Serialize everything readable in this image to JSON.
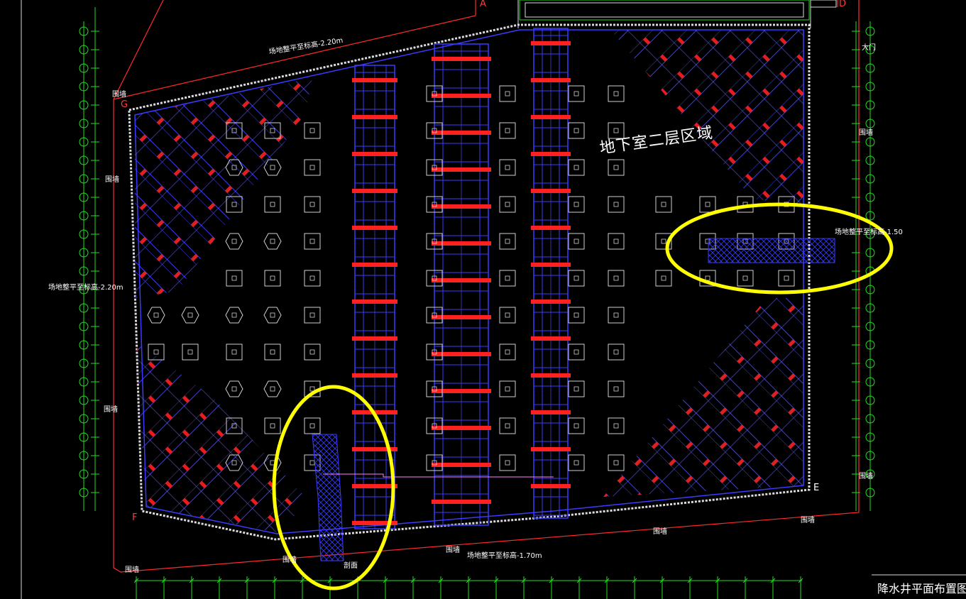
{
  "drawing": {
    "title": "降水井平面布置图",
    "zone_label": "地下室二层区域",
    "gate_label": "大门",
    "wall_label": "围墙",
    "cut_label": "剖面",
    "elevations": [
      "场地整平至标高-2.20m",
      "场地整平至标高-2.20m",
      "场地整平至标高-1.50",
      "场地整平至标高-1.70m"
    ],
    "grid_letters": [
      "A",
      "D",
      "G",
      "E",
      "F"
    ]
  },
  "colors": {
    "background": "#000000",
    "structure": "#2f2fff",
    "beam": "#ff2020",
    "boundary": "#ff2a2a",
    "dimension": "#20e020",
    "highlight": "#ffff00",
    "text": "#ffffff"
  }
}
